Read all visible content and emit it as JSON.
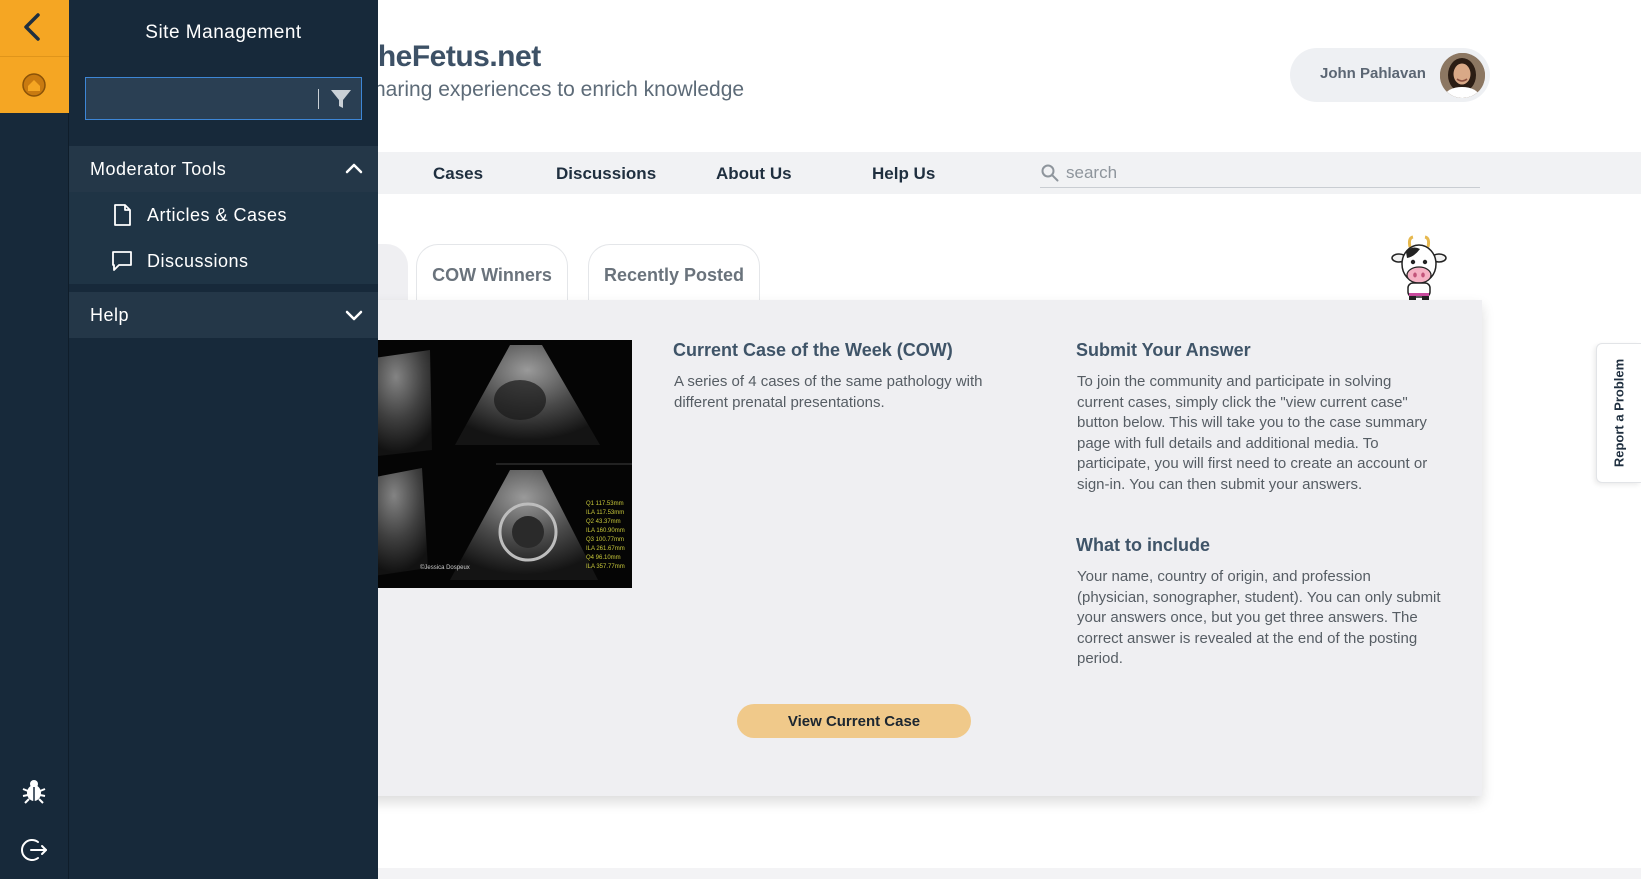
{
  "site": {
    "title": "TheFetus.net",
    "tagline": "Sharing experiences to enrich knowledge"
  },
  "user": {
    "name": "John Pahlavan"
  },
  "nav": {
    "items": [
      {
        "label": "Cases"
      },
      {
        "label": "Discussions"
      },
      {
        "label": "About Us"
      },
      {
        "label": "Help Us"
      }
    ],
    "search_placeholder": "search"
  },
  "tabs": [
    {
      "label": "COW Winners"
    },
    {
      "label": "Recently Posted"
    }
  ],
  "report_problem": "Report a Problem",
  "cow_card": {
    "image": {
      "caption": "©Jessica Dospeux",
      "readouts": [
        "Q1 117.53mm",
        "ILA 117.53mm",
        "Q2 43.37mm",
        "ILA 160.90mm",
        "Q3 100.77mm",
        "ILA 261.67mm",
        "Q4 96.10mm",
        "ILA 357.77mm"
      ]
    },
    "current_heading": "Current Case of the Week (COW)",
    "current_text": "A series of 4 cases of the same pathology with different prenatal presentations.",
    "submit_heading": "Submit Your Answer",
    "submit_text": "To join the community and participate in solving current cases, simply click the \"view current case\" button below. This will take you to the case summary page with full details and additional media. To participate, you will first need to create an account or sign-in. You can then submit your answers.",
    "include_heading": "What to include",
    "include_text": "Your name, country of origin, and profession (physician, sonographer, student). You can only submit your answers once, but you get three answers. The correct answer is revealed at the end of the posting period.",
    "button_label": "View Current Case"
  },
  "drawer": {
    "title": "Site Management",
    "filter_value": "",
    "sections": [
      {
        "label": "Moderator Tools",
        "expanded": true,
        "items": [
          {
            "label": "Articles & Cases",
            "icon": "document-icon"
          },
          {
            "label": "Discussions",
            "icon": "comment-icon"
          }
        ]
      },
      {
        "label": "Help",
        "expanded": false
      }
    ]
  },
  "rail": {
    "icons": [
      "back-arrow-icon",
      "home-icon",
      "bug-icon",
      "logout-icon"
    ]
  },
  "colors": {
    "accent": "#f5a623",
    "drawer_bg": "#17293a",
    "drawer_section": "#243748",
    "button": "#f0c98a",
    "heading": "#3f5468"
  }
}
